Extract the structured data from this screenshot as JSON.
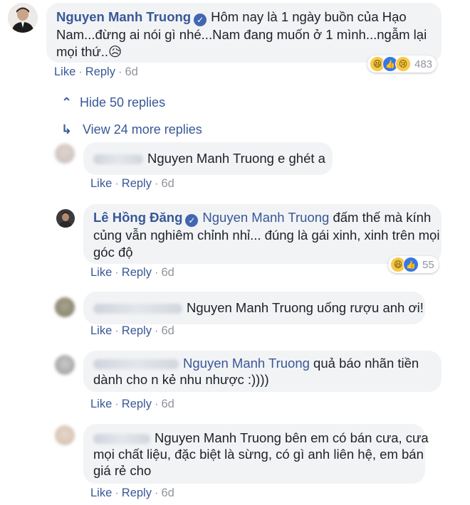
{
  "main_comment": {
    "author": "Nguyen Manh Truong",
    "text_line1": "Hôm nay là 1 ngày buồn của Hạo",
    "text_line2": "Nam...đừng ai nói gì nhé...Nam đang muốn ở 1 mình...ngẫm lại",
    "text_line3": "mọi thứ..",
    "emoji": "😥",
    "like": "Like",
    "reply": "Reply",
    "time": "6d",
    "reaction_count": "483"
  },
  "hide_replies": "Hide 50 replies",
  "more_replies": "View 24 more replies",
  "replies": [
    {
      "tag": "Nguyen Manh Truong",
      "text": " e ghét a",
      "like": "Like",
      "reply": "Reply",
      "time": "6d"
    },
    {
      "author": "Lê Hồng Đăng",
      "tag": "Nguyen Manh Truong",
      "text_line1": " đấm thế mà kính",
      "text_line2": "củng vẫn nghiêm chỉnh nhỉ... đúng là gái xinh, xinh trên mọi",
      "text_line3": "góc độ",
      "like": "Like",
      "reply": "Reply",
      "time": "6d",
      "reaction_count": "55"
    },
    {
      "tag": "Nguyen Manh Truong",
      "text": " uống rượu anh ơi!",
      "like": "Like",
      "reply": "Reply",
      "time": "6d"
    },
    {
      "tag": "Nguyen Manh Truong",
      "text_line1": " quả báo nhãn tiền",
      "text_line2": "dành cho n kẻ nhu nhược :))))",
      "like": "Like",
      "reply": "Reply",
      "time": "6d"
    },
    {
      "tag": "Nguyen Manh Truong",
      "text_line1": " bên em có bán cưa, cưa",
      "text_line2": "mọi chất liệu, đặc biệt là sừng, có gì anh liên hệ, em bán",
      "text_line3": "giá rẻ cho",
      "like": "Like",
      "reply": "Reply",
      "time": "6d"
    }
  ],
  "icons": {
    "verified": "✓",
    "hide_chevron": "⌃",
    "more_arrow": "↳",
    "haha": "😆",
    "like": "👍",
    "sad": "😢"
  },
  "colors": {
    "link": "#385898",
    "bubble": "#f2f3f5",
    "meta": "#90949c"
  }
}
